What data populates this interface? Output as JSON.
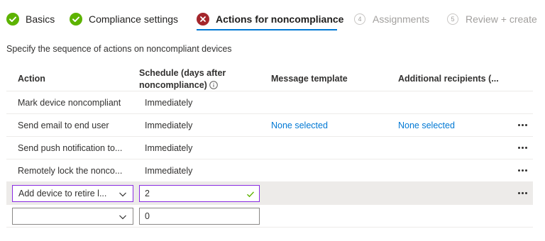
{
  "wizard": {
    "steps": [
      {
        "label": "Basics",
        "state": "completed"
      },
      {
        "label": "Compliance settings",
        "state": "completed"
      },
      {
        "label": "Actions for noncompliance",
        "state": "error"
      },
      {
        "number": "4",
        "label": "Assignments",
        "state": "upcoming"
      },
      {
        "number": "5",
        "label": "Review + create",
        "state": "upcoming"
      }
    ]
  },
  "description": "Specify the sequence of actions on noncompliant devices",
  "table": {
    "columns": {
      "action": "Action",
      "schedule_line1": "Schedule (days after",
      "schedule_line2": "noncompliance)",
      "message_template": "Message template",
      "additional_recipients": "Additional recipients (..."
    },
    "rows": [
      {
        "action": "Mark device noncompliant",
        "schedule": "Immediately",
        "message_template": "",
        "additional_recipients": "",
        "has_menu": false
      },
      {
        "action": "Send email to end user",
        "schedule": "Immediately",
        "message_template": "None selected",
        "additional_recipients": "None selected",
        "has_menu": true
      },
      {
        "action": "Send push notification to...",
        "schedule": "Immediately",
        "message_template": "",
        "additional_recipients": "",
        "has_menu": true
      },
      {
        "action": "Remotely lock the nonco...",
        "schedule": "Immediately",
        "message_template": "",
        "additional_recipients": "",
        "has_menu": true
      }
    ],
    "edit_row": {
      "action_selected": "Add device to retire l...",
      "schedule_value": "2"
    },
    "new_row": {
      "action_selected": "",
      "schedule_value": "0"
    }
  },
  "colors": {
    "success": "#5db300",
    "error": "#a4262c",
    "accent": "#0078d4",
    "focus_border": "#8a2be2",
    "selected_row": "#edebe9"
  },
  "icons": {
    "completed": "check-circle-icon",
    "error": "error-circle-icon",
    "info": "info-icon",
    "dropdown": "chevron-down-icon",
    "more": "more-ellipsis-icon",
    "valid": "checkmark-icon"
  }
}
